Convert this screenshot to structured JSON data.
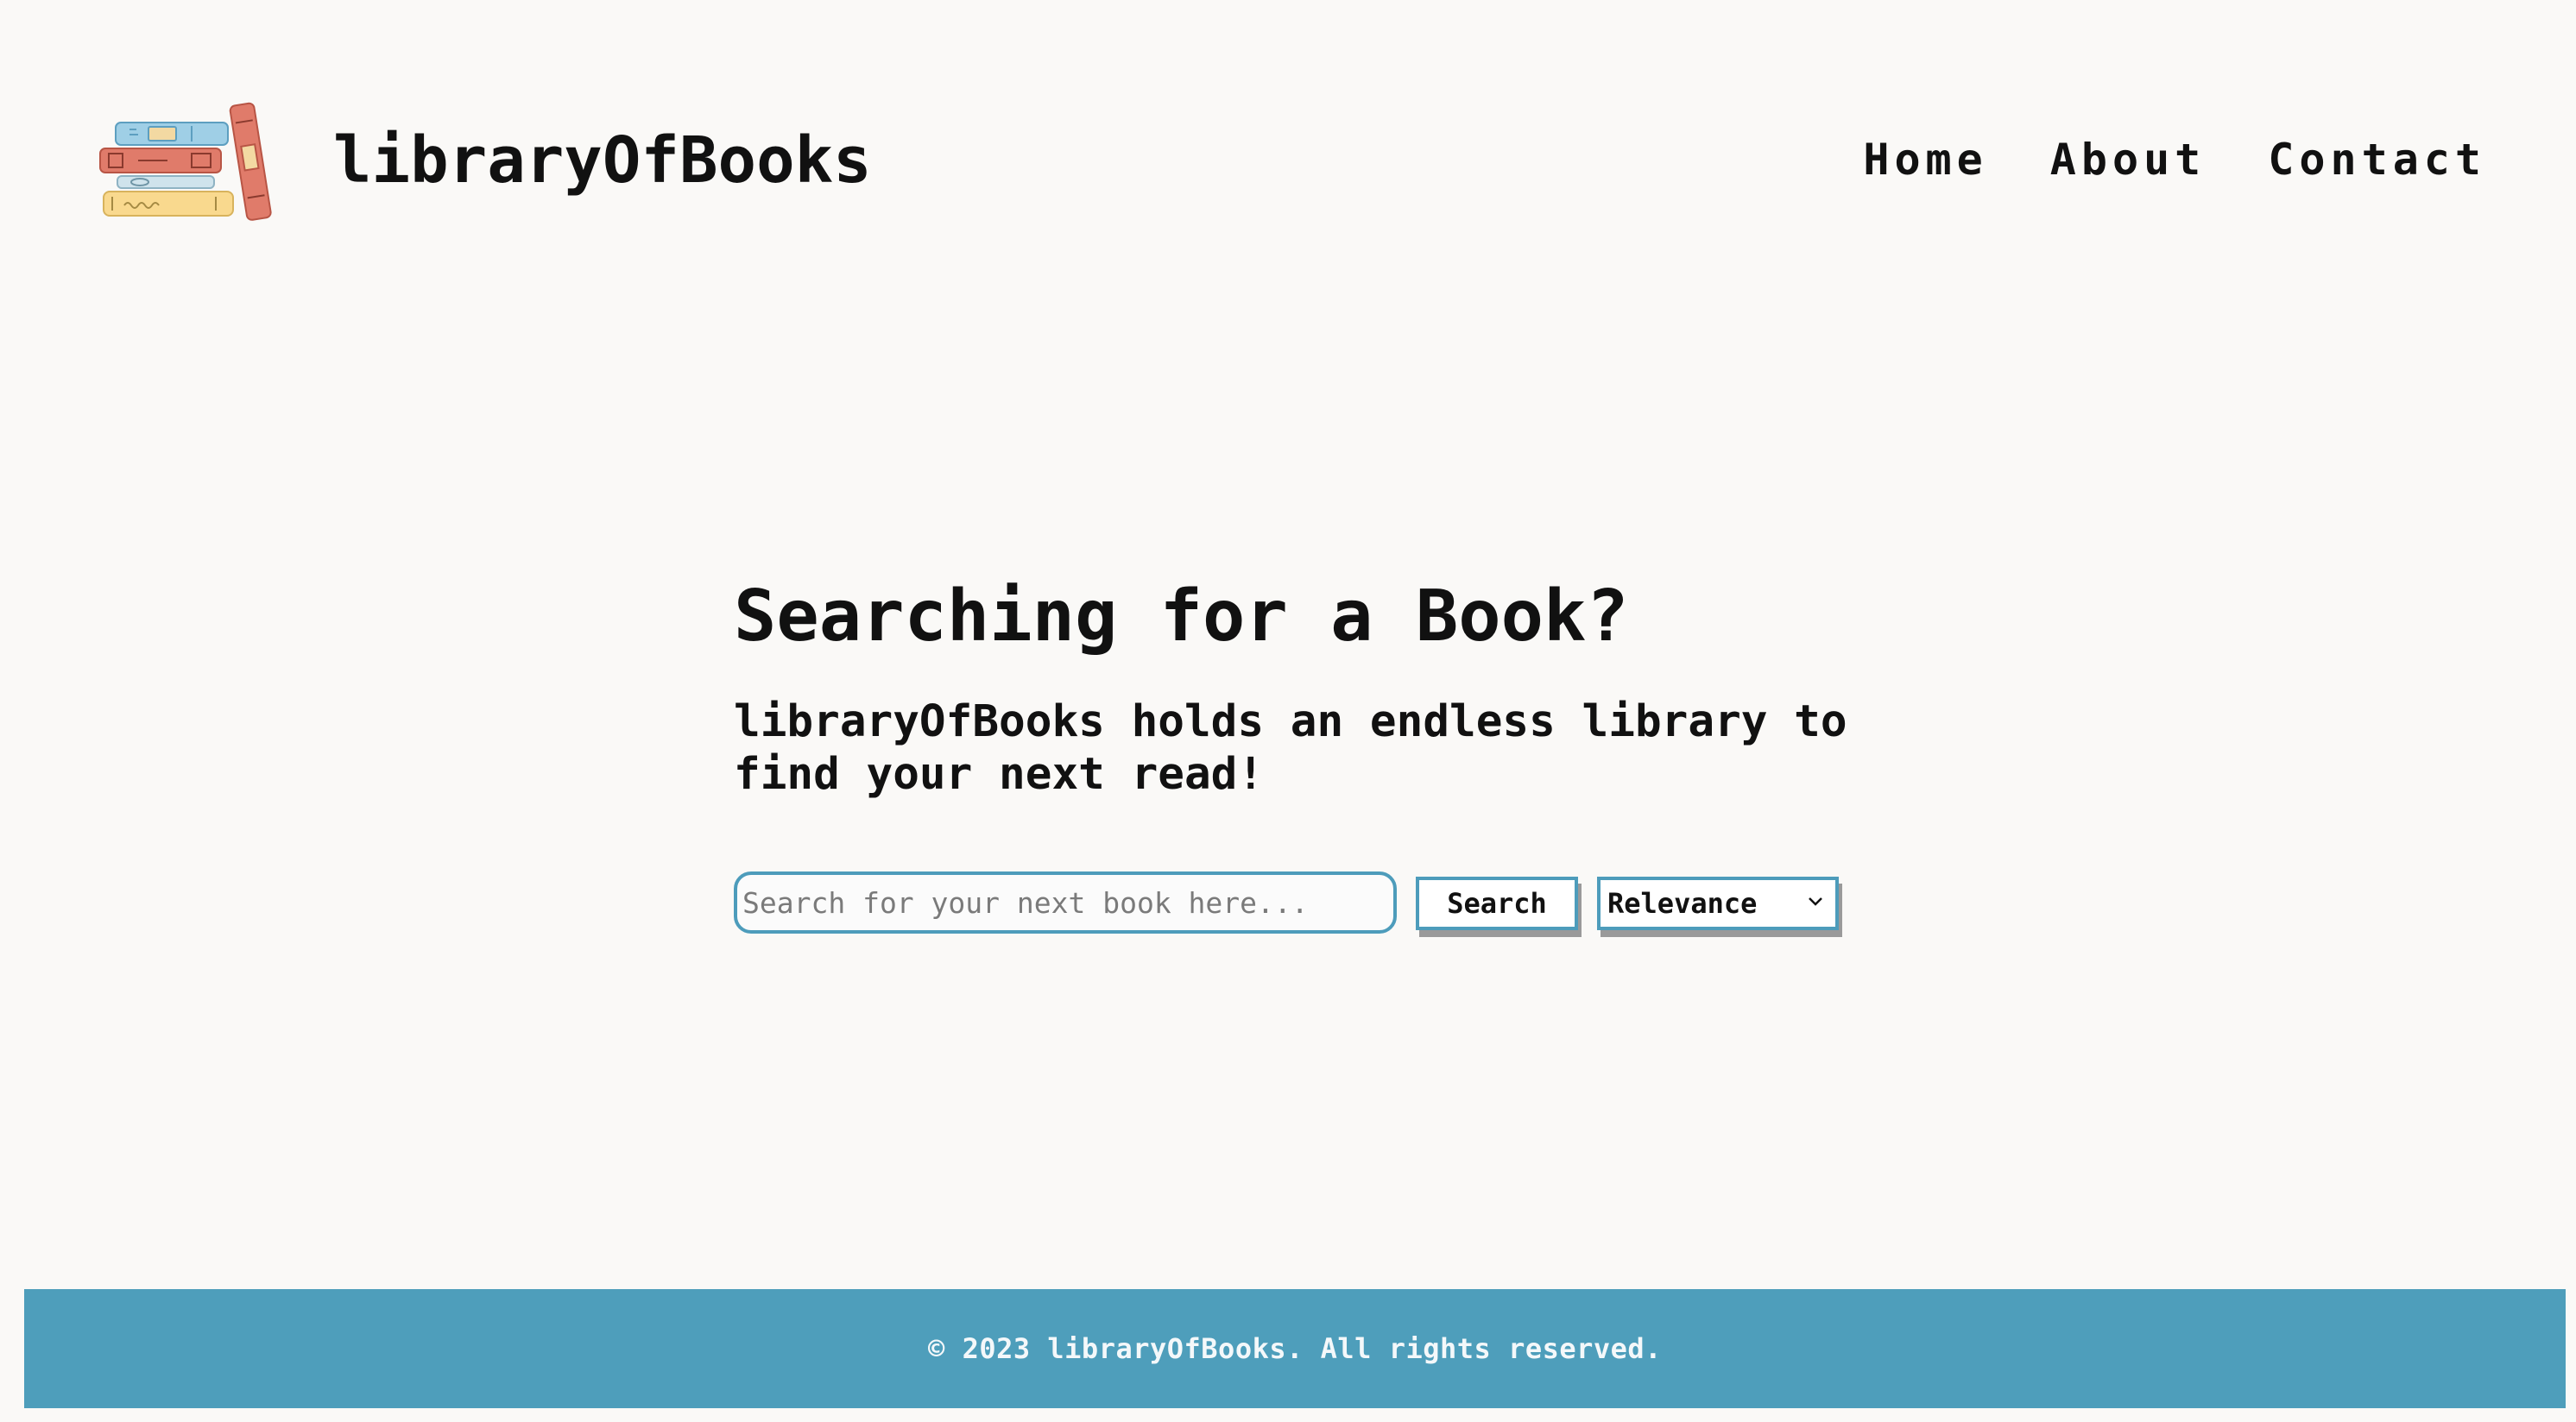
{
  "header": {
    "site_title": "libraryOfBooks",
    "logo_icon": "book-stack-icon",
    "nav": [
      {
        "label": "Home"
      },
      {
        "label": "About"
      },
      {
        "label": "Contact"
      }
    ]
  },
  "hero": {
    "heading": "Searching for a Book?",
    "subheading": "libraryOfBooks holds an endless library to find your next read!"
  },
  "search": {
    "placeholder": "Search for your next book here...",
    "value": "",
    "button_label": "Search",
    "sort_selected": "Relevance"
  },
  "footer": {
    "text": "© 2023 libraryOfBooks. All rights reserved."
  },
  "colors": {
    "accent": "#4e9ebb",
    "background": "#faf9f7",
    "text": "#111111",
    "footer_text": "#f4f8fa",
    "book_blue": "#9fcfe6",
    "book_red": "#e07b6a",
    "book_yellow": "#f9d98e"
  }
}
